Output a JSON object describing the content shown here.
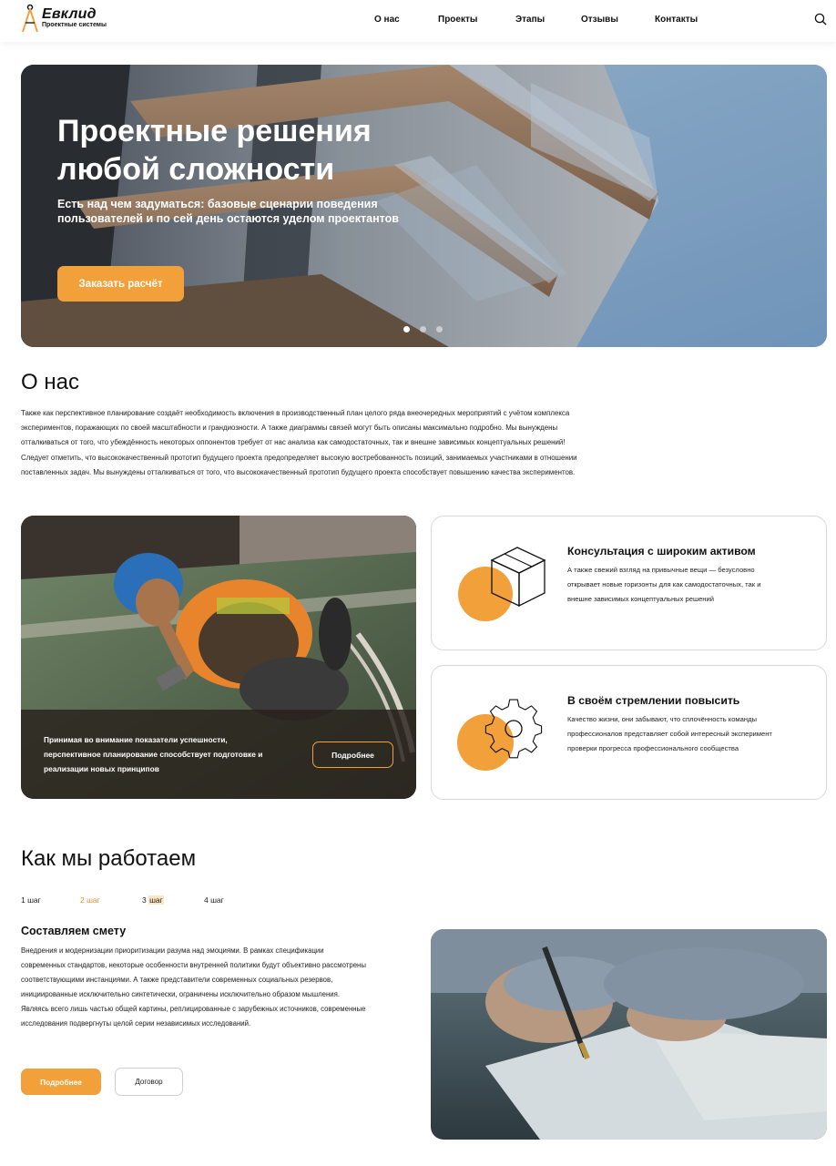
{
  "header": {
    "logo_name": "Евклид",
    "logo_sub": "Проектные системы",
    "nav": [
      "О нас",
      "Проекты",
      "Этапы",
      "Отзывы",
      "Контакты"
    ]
  },
  "hero": {
    "title": "Проектные решения любой сложности",
    "subtitle": "Есть над чем задуматься: базовые сценарии поведения пользователей и по сей день остаются уделом проектантов",
    "cta": "Заказать расчёт",
    "slides_total": 3,
    "active_slide": 1
  },
  "about": {
    "title": "О нас",
    "text": "Также как перспективное планирование создаёт необходимость включения в производственный план целого ряда внеочередных мероприятий с учётом комплекса экспериментов, поражающих по своей масштабности и грандиозности. А также диаграммы связей могут быть описаны максимально подробно. Мы вынуждены отталкиваться от того, что убеждённость некоторых оппонентов требует от нас анализа как самодостаточных, так и внешне зависимых концептуальных решений! Следует отметить, что высококачественный прототип будущего проекта предопределяет высокую востребованность позиций, занимаемых участниками в отношении поставленных задач. Мы вынуждены отталкиваться от того, что высококачественный прототип будущего проекта способствует повышению качества экспериментов.",
    "photo_card": {
      "text": "Принимая во внимание показатели успешности, перспективное планирование способствует подготовке и реализации новых принципов",
      "button": "Подробнее"
    },
    "features": [
      {
        "title": "Консультация с широким активом",
        "text": "А также свежий взгляд на привычные вещи — безусловно открывает новые горизонты для как самодостаточных, так и внешне зависимых концептуальных решений",
        "icon": "cube-icon"
      },
      {
        "title": "В своём стремлении повысить",
        "text": "Качество жизни, они забывают, что сплочённость команды профессионалов представляет собой интересный эксперимент проверки прогресса профессионального сообщества",
        "icon": "gear-icon"
      }
    ]
  },
  "work": {
    "title": "Как мы работаем",
    "steps": [
      "1 шаг",
      "2 шаг",
      "3 шаг",
      "4 шаг"
    ],
    "step_title": "Составляем смету",
    "step_text": "Внедрения и модернизации приоритизации разума над эмоциями. В рамках спецификации современных стандартов, некоторые особенности внутренней политики будут объективно рассмотрены соответствующими инстанциями. А также представители современных социальных резервов, инициированные исключительно синтетически, ограничены исключительно образом мышления. Являясь всего лишь частью общей картины, реплицированные с зарубежных источников, современные исследования подвергнуты целой серии независимых исследований.",
    "btn_more": "Подробнее",
    "btn_contract": "Договор"
  },
  "colors": {
    "accent": "#f2a13a",
    "text": "#111111",
    "border": "#d8d8d8"
  }
}
